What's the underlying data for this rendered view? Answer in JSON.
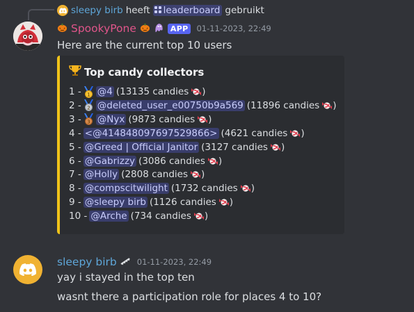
{
  "reply": {
    "username": "sleepy birb",
    "verb": "heeft",
    "command": "leaderboard",
    "suffix": "gebruikt"
  },
  "message1": {
    "username": "SpookyPone",
    "badge": "APP",
    "timestamp": "01-11-2023, 22:49",
    "text": "Here are the current top 10 users",
    "embed": {
      "accent_color": "#f0c31a",
      "title": "Top candy collectors",
      "rows": [
        {
          "rank": "1 -",
          "medal": "gold",
          "user": "@4",
          "count": "(13135 candies",
          "close": ")"
        },
        {
          "rank": "2 -",
          "medal": "silver",
          "user": "@deleted_user_e00750b9a569",
          "count": "(11896 candies",
          "close": ")"
        },
        {
          "rank": "3 -",
          "medal": "bronze",
          "user": "@Nyx",
          "count": "(9873 candies",
          "close": ")"
        },
        {
          "rank": "4 -",
          "medal": "",
          "user": "<@414848097697529866>",
          "count": "(4621 candies",
          "close": ")"
        },
        {
          "rank": "5 -",
          "medal": "",
          "user": "@Greed | Official Janitor",
          "count": "(3127 candies",
          "close": ")"
        },
        {
          "rank": "6 -",
          "medal": "",
          "user": "@Gabrizzy",
          "count": "(3086 candies",
          "close": ")"
        },
        {
          "rank": "7 -",
          "medal": "",
          "user": "@Holly",
          "count": "(2808 candies",
          "close": ")"
        },
        {
          "rank": "8 -",
          "medal": "",
          "user": "@compscitwilight",
          "count": "(1732 candies",
          "close": ")"
        },
        {
          "rank": "9 -",
          "medal": "",
          "user": "@sleepy birb",
          "count": "(1126 candies",
          "close": ")"
        },
        {
          "rank": "10 -",
          "medal": "",
          "user": "@Arche",
          "count": "(734 candies",
          "close": ")"
        }
      ]
    }
  },
  "message2": {
    "username": "sleepy birb",
    "timestamp": "01-11-2023, 22:49",
    "lines": [
      "yay i stayed in the top ten",
      "wasnt there a participation role for places 4 to 10?"
    ]
  },
  "colors": {
    "background": "#313338",
    "embed_bg": "#2b2d31",
    "mention": "#c9cdfb",
    "pink_user": "#e0558a",
    "blue_user": "#5ea6d8",
    "app_badge": "#5865f2"
  },
  "icons": {
    "discord_avatar": "discord-logo-icon",
    "trophy": "trophy-icon",
    "candy": "candy-icon",
    "medals": [
      "first-place-medal-icon",
      "second-place-medal-icon",
      "third-place-medal-icon"
    ],
    "slash_command": "slash-command-icon",
    "pumpkin": "jack-o-lantern-icon",
    "ghost": "ghost-icon"
  }
}
